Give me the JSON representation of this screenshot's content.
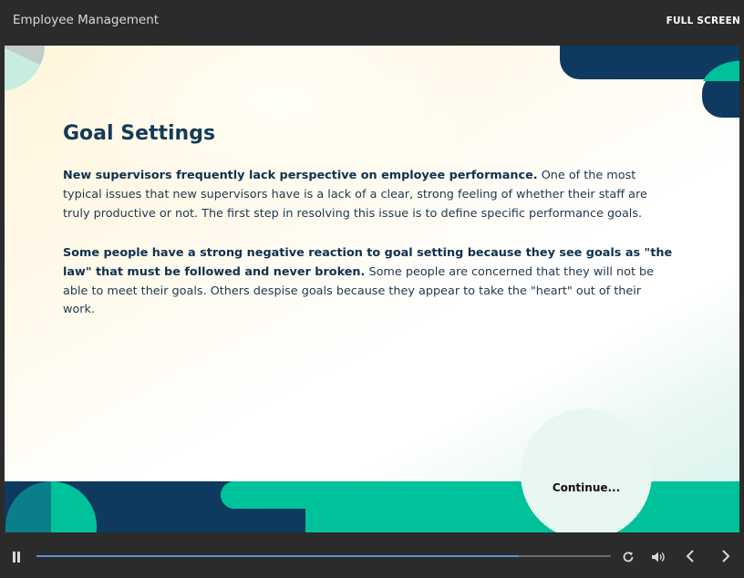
{
  "header": {
    "app_title": "Employee Management",
    "full_screen_label": "FULL SCREEN"
  },
  "slide": {
    "title": "Goal Settings",
    "paragraphs": [
      {
        "lead": "New supervisors frequently lack perspective on employee performance.",
        "body": " One of the most typical issues that new supervisors have is a lack of a clear, strong feeling of whether their staff are truly productive or not. The first step in resolving this issue is to define specific performance goals."
      },
      {
        "lead": "Some people have a strong negative reaction to goal setting because they see goals as \"the law\" that must be followed and never broken.",
        "body": " Some people are concerned that they will not be able to meet their goals. Others despise goals because they appear to take the \"heart\" out of their work."
      }
    ],
    "continue_label": "Continue..."
  },
  "player": {
    "progress_fraction": 0.84,
    "controls": {
      "play_pause_icon": "pause-icon",
      "replay_icon": "replay-icon",
      "volume_icon": "volume-icon",
      "prev_icon": "chevron-left-icon",
      "next_icon": "chevron-right-icon"
    }
  },
  "colors": {
    "dark_navy": "#0d3a5e",
    "teal": "#00c29a",
    "dark_teal": "#0a7f8a",
    "title_text": "#153a57",
    "progress": "#5b8fd4"
  }
}
